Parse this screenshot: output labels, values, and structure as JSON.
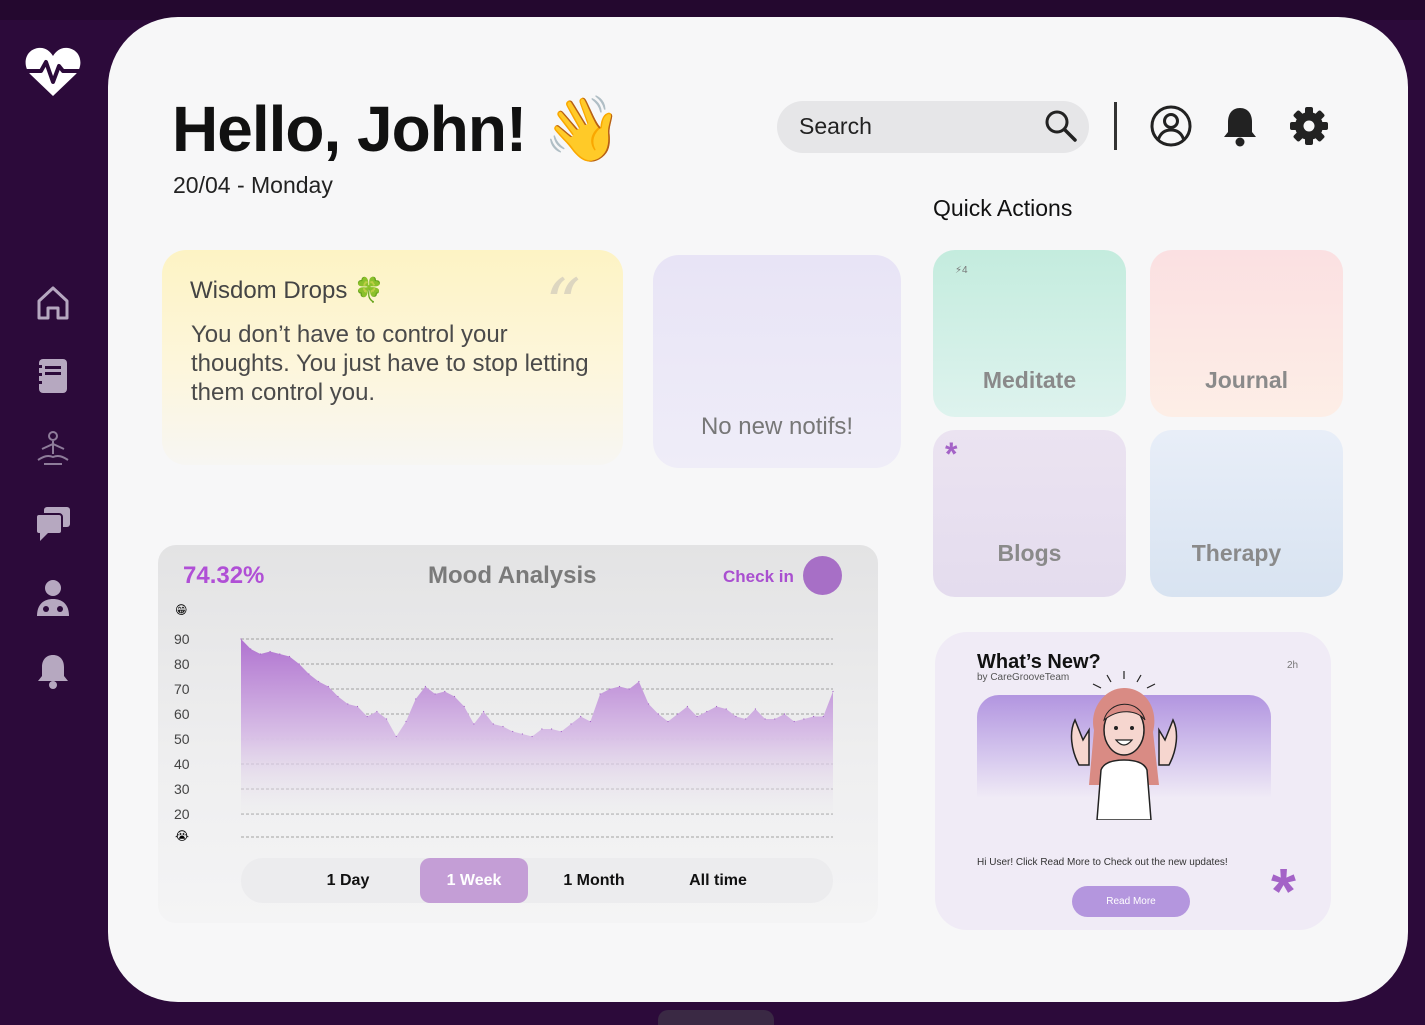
{
  "header": {
    "greeting": "Hello, John! 👋",
    "date": "20/04 - Monday",
    "search_placeholder": "Search"
  },
  "quick_actions": {
    "title": "Quick Actions",
    "meditate": {
      "label": "Meditate",
      "streak": "⚡4"
    },
    "journal": {
      "label": "Journal"
    },
    "blogs": {
      "label": "Blogs",
      "mark": "*"
    },
    "therapy": {
      "label": "Therapy"
    }
  },
  "wisdom": {
    "title": "Wisdom Drops 🍀",
    "quote_mark": "“",
    "quote": "You don’t have to control your thoughts. You just have to stop letting them control you."
  },
  "notifications": {
    "empty_text": "No new notifs!"
  },
  "mood": {
    "percentage": "74.32%",
    "title": "Mood Analysis",
    "checkin_label": "Check in",
    "top_emoji": "😁",
    "bottom_emoji": "😭",
    "ranges": [
      "1 Day",
      "1 Week",
      "1 Month",
      "All time"
    ],
    "active_range": "1 Week"
  },
  "chart_data": {
    "type": "area",
    "title": "Mood Analysis",
    "y_ticks": [
      90,
      80,
      70,
      60,
      50,
      40,
      30,
      20
    ],
    "ylim": [
      15,
      92
    ],
    "grid": true,
    "color": "#b57fd0",
    "values": [
      90,
      86,
      84,
      85,
      84,
      83,
      80,
      76,
      73,
      71,
      67,
      64,
      63,
      59,
      61,
      58,
      51,
      57,
      66,
      71,
      68,
      69,
      67,
      63,
      56,
      61,
      56,
      55,
      53,
      52,
      51,
      54,
      54,
      53,
      56,
      59,
      57,
      68,
      70,
      71,
      70,
      73,
      64,
      60,
      57,
      60,
      63,
      59,
      61,
      63,
      62,
      59,
      58,
      62,
      58,
      58,
      60,
      57,
      58,
      59,
      59,
      69
    ]
  },
  "whats_new": {
    "title": "What’s New?",
    "byline": "by CareGrooveTeam",
    "time": "2h",
    "body": "Hi User! Click Read More to Check out the new updates!",
    "button": "Read More",
    "mark": "*"
  },
  "colors": {
    "sidebar_bg": "#2c0a3a",
    "accent": "#a463c7",
    "panel_bg": "#f7f7f8"
  },
  "icons": [
    "heartbeat-logo-icon",
    "home-icon",
    "journal-icon",
    "meditation-icon",
    "chat-icon",
    "doctor-icon",
    "bell-icon",
    "search-icon",
    "user-icon",
    "settings-icon"
  ]
}
